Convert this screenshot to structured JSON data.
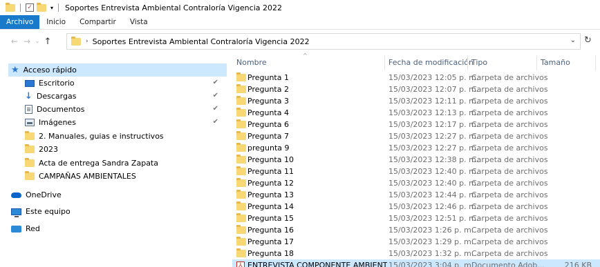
{
  "window": {
    "title": "Soportes Entrevista Ambiental Contraloría Vigencia 2022"
  },
  "ribbon": {
    "tabs": [
      "Archivo",
      "Inicio",
      "Compartir",
      "Vista"
    ]
  },
  "address": {
    "path": "Soportes Entrevista Ambiental Contraloría Vigencia 2022"
  },
  "sidebar": {
    "quick_access": "Acceso rápido",
    "items": [
      {
        "label": "Escritorio",
        "icon": "desktop-icon",
        "pinned": true
      },
      {
        "label": "Descargas",
        "icon": "download-icon",
        "pinned": true
      },
      {
        "label": "Documentos",
        "icon": "documents-icon",
        "pinned": true
      },
      {
        "label": "Imágenes",
        "icon": "images-icon",
        "pinned": true
      },
      {
        "label": "2. Manuales, guias e instructivos",
        "icon": "folder-icon",
        "pinned": false
      },
      {
        "label": "2023",
        "icon": "folder-icon",
        "pinned": false
      },
      {
        "label": "Acta de entrega Sandra Zapata",
        "icon": "folder-icon",
        "pinned": false
      },
      {
        "label": "CAMPAÑAS AMBIENTALES",
        "icon": "folder-icon",
        "pinned": false
      }
    ],
    "onedrive": "OneDrive",
    "this_pc": "Este equipo",
    "network": "Red"
  },
  "columns": {
    "name": "Nombre",
    "date": "Fecha de modificación",
    "type": "Tipo",
    "size": "Tamaño"
  },
  "files": [
    {
      "name": "Pregunta 1",
      "date": "15/03/2023 12:05 p. m.",
      "type": "Carpeta de archivos",
      "size": ""
    },
    {
      "name": "Pregunta 2",
      "date": "15/03/2023 12:07 p. m.",
      "type": "Carpeta de archivos",
      "size": ""
    },
    {
      "name": "Pregunta 3",
      "date": "15/03/2023 12:11 p. m.",
      "type": "Carpeta de archivos",
      "size": ""
    },
    {
      "name": "Pregunta 4",
      "date": "15/03/2023 12:13 p. m.",
      "type": "Carpeta de archivos",
      "size": ""
    },
    {
      "name": "Pregunta 6",
      "date": "15/03/2023 12:17 p. m.",
      "type": "Carpeta de archivos",
      "size": ""
    },
    {
      "name": "Pregunta 7",
      "date": "15/03/2023 12:27 p. m.",
      "type": "Carpeta de archivos",
      "size": ""
    },
    {
      "name": "pregunta 9",
      "date": "15/03/2023 12:27 p. m.",
      "type": "Carpeta de archivos",
      "size": ""
    },
    {
      "name": "Pregunta 10",
      "date": "15/03/2023 12:38 p. m.",
      "type": "Carpeta de archivos",
      "size": ""
    },
    {
      "name": "Pregunta 11",
      "date": "15/03/2023 12:40 p. m.",
      "type": "Carpeta de archivos",
      "size": ""
    },
    {
      "name": "Pregunta 12",
      "date": "15/03/2023 12:40 p. m.",
      "type": "Carpeta de archivos",
      "size": ""
    },
    {
      "name": "Pregunta 13",
      "date": "15/03/2023 12:44 p. m.",
      "type": "Carpeta de archivos",
      "size": ""
    },
    {
      "name": "Pregunta 14",
      "date": "15/03/2023 12:46 p. m.",
      "type": "Carpeta de archivos",
      "size": ""
    },
    {
      "name": "Pregunta 15",
      "date": "15/03/2023 12:51 p. m.",
      "type": "Carpeta de archivos",
      "size": ""
    },
    {
      "name": "Pregunta 16",
      "date": "15/03/2023 1:26 p. m.",
      "type": "Carpeta de archivos",
      "size": ""
    },
    {
      "name": "Pregunta 17",
      "date": "15/03/2023 1:29 p. m.",
      "type": "Carpeta de archivos",
      "size": ""
    },
    {
      "name": "Pregunta 18",
      "date": "15/03/2023 1:32 p. m.",
      "type": "Carpeta de archivos",
      "size": ""
    },
    {
      "name": "ENTREVISTA COMPONENTE AMBIENTAL ...",
      "date": "15/03/2023 3:04 p. m.",
      "type": "Documento Adob...",
      "size": "216 KB",
      "pdf": true,
      "selected": true
    }
  ]
}
